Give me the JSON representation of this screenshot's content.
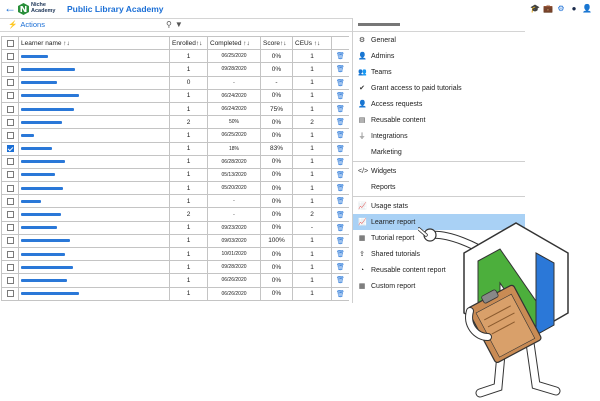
{
  "header": {
    "logo_line1": "Niche",
    "logo_line2": "Academy",
    "title": "Public Library Academy",
    "icons": [
      "graduation-cap-icon",
      "briefcase-icon",
      "gear-icon",
      "dark-circle-icon",
      "user-icon"
    ]
  },
  "toolbar": {
    "actions_label": "Actions"
  },
  "table": {
    "headers": {
      "name": "Learner name ↑↓",
      "enrolled": "Enrolled↑↓",
      "completed": "Completed ↑↓",
      "score": "Score↑↓",
      "ceus": "CEUs ↑↓"
    },
    "rows": [
      {
        "bar": 0.45,
        "enrolled": "1",
        "completed": "06/25/2020",
        "score": "0%",
        "ceus": "1",
        "checked": false
      },
      {
        "bar": 0.9,
        "enrolled": "1",
        "completed": "09/28/2020",
        "score": "0%",
        "ceus": "1",
        "checked": false
      },
      {
        "bar": 0.6,
        "enrolled": "0",
        "completed": "-",
        "score": "-",
        "ceus": "1",
        "checked": false
      },
      {
        "bar": 0.96,
        "enrolled": "1",
        "completed": "06/24/2020",
        "score": "0%",
        "ceus": "1",
        "checked": false
      },
      {
        "bar": 0.88,
        "enrolled": "1",
        "completed": "06/24/2020",
        "score": "75%",
        "ceus": "1",
        "checked": false
      },
      {
        "bar": 0.68,
        "enrolled": "2",
        "completed": "50%",
        "score": "0%",
        "ceus": "2",
        "checked": false
      },
      {
        "bar": 0.22,
        "enrolled": "1",
        "completed": "06/25/2020",
        "score": "0%",
        "ceus": "1",
        "checked": false
      },
      {
        "bar": 0.52,
        "enrolled": "1",
        "completed": "18%",
        "score": "83%",
        "ceus": "1",
        "checked": true
      },
      {
        "bar": 0.74,
        "enrolled": "1",
        "completed": "06/28/2020",
        "score": "0%",
        "ceus": "1",
        "checked": false
      },
      {
        "bar": 0.57,
        "enrolled": "1",
        "completed": "05/13/2020",
        "score": "0%",
        "ceus": "1",
        "checked": false
      },
      {
        "bar": 0.7,
        "enrolled": "1",
        "completed": "05/20/2020",
        "score": "0%",
        "ceus": "1",
        "checked": false
      },
      {
        "bar": 0.33,
        "enrolled": "1",
        "completed": "-",
        "score": "0%",
        "ceus": "1",
        "checked": false
      },
      {
        "bar": 0.66,
        "enrolled": "2",
        "completed": "-",
        "score": "0%",
        "ceus": "2",
        "checked": false
      },
      {
        "bar": 0.6,
        "enrolled": "1",
        "completed": "09/23/2020",
        "score": "0%",
        "ceus": "-",
        "checked": false
      },
      {
        "bar": 0.82,
        "enrolled": "1",
        "completed": "09/03/2020",
        "score": "100%",
        "ceus": "1",
        "checked": false
      },
      {
        "bar": 0.73,
        "enrolled": "1",
        "completed": "10/01/2020",
        "score": "0%",
        "ceus": "1",
        "checked": false
      },
      {
        "bar": 0.86,
        "enrolled": "1",
        "completed": "09/28/2020",
        "score": "0%",
        "ceus": "1",
        "checked": false
      },
      {
        "bar": 0.76,
        "enrolled": "1",
        "completed": "06/26/2020",
        "score": "0%",
        "ceus": "1",
        "checked": false
      },
      {
        "bar": 0.96,
        "enrolled": "1",
        "completed": "06/26/2020",
        "score": "0%",
        "ceus": "1",
        "checked": false
      }
    ]
  },
  "sidebar": {
    "items": [
      {
        "icon": "⚙",
        "icon_name": "gear-icon",
        "label": "General",
        "active": false
      },
      {
        "icon": "👤",
        "icon_name": "user-icon",
        "label": "Admins",
        "active": false
      },
      {
        "icon": "👥",
        "icon_name": "users-icon",
        "label": "Teams",
        "active": false
      },
      {
        "icon": "✔",
        "icon_name": "check-icon",
        "label": "Grant access to paid tutorials",
        "active": false
      },
      {
        "icon": "👤",
        "icon_name": "user-plus-icon",
        "label": "Access requests",
        "active": false
      },
      {
        "icon": "▤",
        "icon_name": "content-icon",
        "label": "Reusable content",
        "active": false
      },
      {
        "icon": "⏚",
        "icon_name": "plug-icon",
        "label": "Integrations",
        "active": false
      },
      {
        "icon": "",
        "icon_name": "none",
        "label": "Marketing",
        "active": false
      },
      {
        "icon": "</>",
        "icon_name": "code-icon",
        "label": "Widgets",
        "active": false
      },
      {
        "icon": "",
        "icon_name": "none",
        "label": "Reports",
        "active": false
      },
      {
        "icon": "📈",
        "icon_name": "chart-icon",
        "label": "Usage stats",
        "active": false
      },
      {
        "icon": "📈",
        "icon_name": "chart-icon",
        "label": "Learner report",
        "active": true
      },
      {
        "icon": "▦",
        "icon_name": "tutorial-icon",
        "label": "Tutorial report",
        "active": false
      },
      {
        "icon": "⇪",
        "icon_name": "share-icon",
        "label": "Shared tutorials",
        "active": false
      },
      {
        "icon": "◔",
        "icon_name": "pie-icon",
        "label": "Reusable content report",
        "active": false
      },
      {
        "icon": "▦",
        "icon_name": "grid-icon",
        "label": "Custom report",
        "active": false
      }
    ]
  },
  "colors": {
    "accent": "#1b6fd6",
    "active_row": "#a9d1f5",
    "mascot_green": "#4caf3c",
    "mascot_blue": "#2b78d8"
  }
}
